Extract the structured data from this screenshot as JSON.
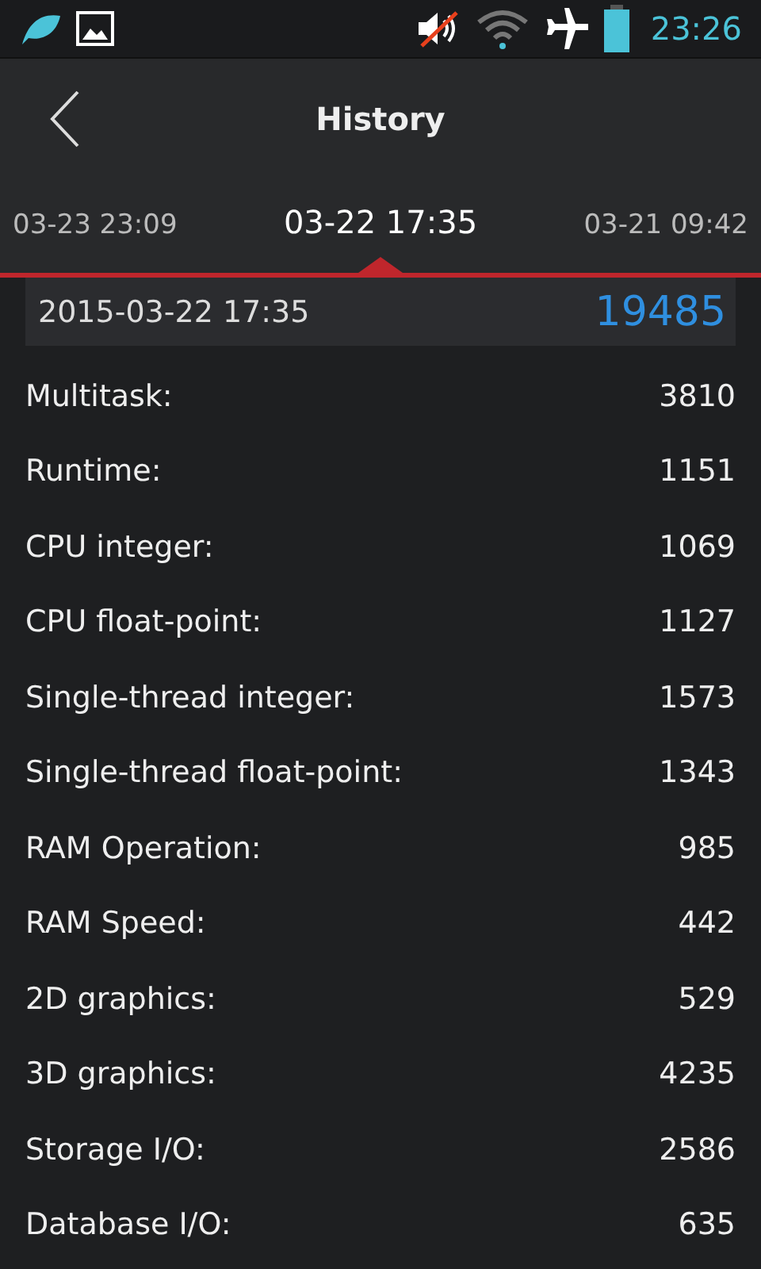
{
  "status_bar": {
    "time": "23:26"
  },
  "header": {
    "title": "History"
  },
  "tabs": [
    {
      "label": "03-23 23:09",
      "selected": false
    },
    {
      "label": "03-22 17:35",
      "selected": true
    },
    {
      "label": "03-21 09:42",
      "selected": false
    }
  ],
  "summary": {
    "date": "2015-03-22 17:35",
    "score": "19485"
  },
  "results": [
    {
      "label": "Multitask:",
      "value": "3810"
    },
    {
      "label": "Runtime:",
      "value": "1151"
    },
    {
      "label": "CPU integer:",
      "value": "1069"
    },
    {
      "label": "CPU float-point:",
      "value": "1127"
    },
    {
      "label": "Single-thread integer:",
      "value": "1573"
    },
    {
      "label": "Single-thread float-point:",
      "value": "1343"
    },
    {
      "label": "RAM Operation:",
      "value": "985"
    },
    {
      "label": "RAM Speed:",
      "value": "442"
    },
    {
      "label": "2D graphics:",
      "value": "529"
    },
    {
      "label": "3D graphics:",
      "value": "4235"
    },
    {
      "label": "Storage I/O:",
      "value": "2586"
    },
    {
      "label": "Database I/O:",
      "value": "635"
    }
  ]
}
